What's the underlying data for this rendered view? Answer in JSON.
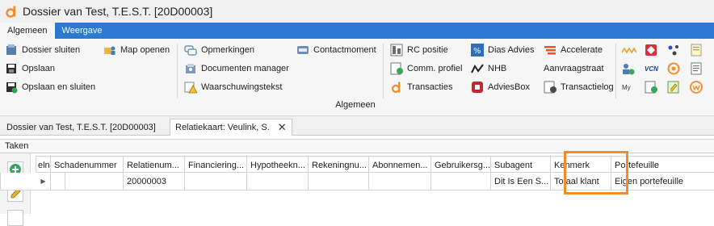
{
  "window": {
    "title": "Dossier van Test,  T.E.S.T. [20D00003]"
  },
  "ribbon": {
    "tabs": [
      {
        "label": "Algemeen"
      },
      {
        "label": "Weergave"
      }
    ],
    "group_label": "Algemeen",
    "buttons": {
      "dossier_sluiten": "Dossier sluiten",
      "opslaan": "Opslaan",
      "opslaan_en_sluiten": "Opslaan en sluiten",
      "map_openen": "Map openen",
      "opmerkingen": "Opmerkingen",
      "documenten_manager": "Documenten manager",
      "waarschuwingstekst": "Waarschuwingstekst",
      "contactmoment": "Contactmoment",
      "rc_positie": "RC positie",
      "comm_profiel": "Comm. profiel",
      "transacties": "Transacties",
      "dias_advies": "Dias Advies",
      "nhb": "NHB",
      "adviesbox": "AdviesBox",
      "accelerate": "Accelerate",
      "aanvraagstraat": "Aanvraagstraat",
      "transactielog": "Transactielog"
    },
    "small_icons": {
      "vcn": "VCN",
      "my": "My"
    }
  },
  "doc_tabs": [
    {
      "label": "Dossier van Test,  T.E.S.T. [20D00003]"
    },
    {
      "label": "Relatiekaart: Veulink, S.",
      "close": "✕"
    }
  ],
  "panel": {
    "title": "Taken"
  },
  "grid": {
    "columns": [
      "eln...",
      "Schadenummer",
      "Relatienum...",
      "Financiering...",
      "Hypotheekn...",
      "Rekeningnu...",
      "Abonnemen...",
      "Gebruikersg...",
      "Subagent",
      "Kenmerk",
      "Portefeuille"
    ],
    "rows": [
      {
        "cells": [
          "",
          "",
          "20000003",
          "",
          "",
          "",
          "",
          "",
          "Dit Is Een S...",
          "Totaal klant",
          "Eigen portefeuille"
        ]
      }
    ]
  },
  "colors": {
    "ribbon_blue": "#2b79d0",
    "highlight": "#f28c28"
  }
}
